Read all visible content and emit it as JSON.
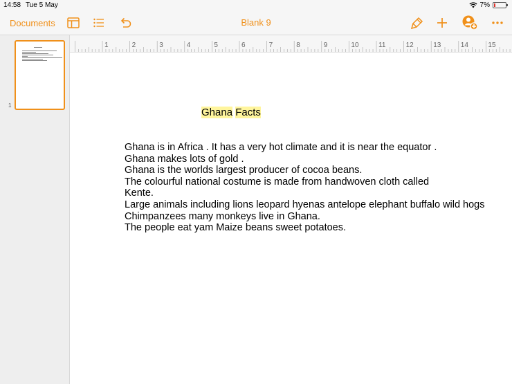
{
  "status": {
    "time": "14:58",
    "date": "Tue 5 May",
    "battery": "7%"
  },
  "toolbar": {
    "documents_label": "Documents",
    "title": "Blank 9",
    "icons": [
      "sidebar-view-icon",
      "list-icon",
      "undo-icon",
      "paintbrush-icon",
      "plus-icon",
      "collaborate-icon",
      "more-icon"
    ]
  },
  "sidebar": {
    "page_number": "1"
  },
  "ruler": {
    "labels": [
      "1",
      "2",
      "3",
      "4",
      "5",
      "6",
      "7",
      "8",
      "9",
      "10",
      "11",
      "12",
      "13",
      "14",
      "15"
    ]
  },
  "document": {
    "title_word1": "Ghana",
    "title_word2": "Facts",
    "lines": [
      "Ghana is in Africa . It has a very hot climate and it is near the equator .",
      "Ghana makes lots of gold .",
      "Ghana is the worlds largest producer of cocoa beans.",
      "The colourful national costume is made from handwoven cloth called",
      "Kente.",
      "Large animals including lions leopard hyenas antelope elephant buffalo wild hogs",
      "Chimpanzees many monkeys live in Ghana.",
      "The people eat yam Maize beans sweet potatoes."
    ]
  },
  "colors": {
    "accent": "#f0901a",
    "highlight": "#fff59d"
  }
}
